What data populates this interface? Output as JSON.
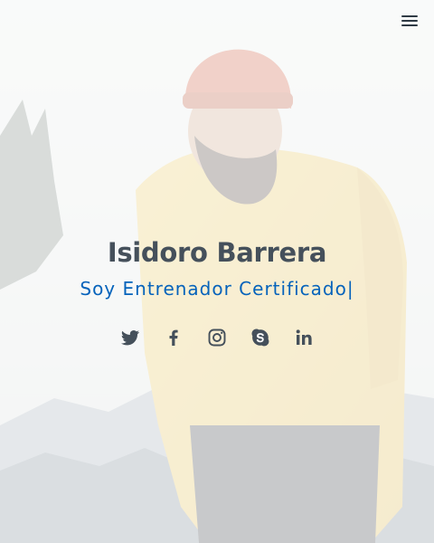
{
  "hero": {
    "name": "Isidoro Barrera",
    "subtitle_prefix": "Soy ",
    "subtitle_typed": "Entrenador Certificado",
    "cursor": "|"
  },
  "menu": {
    "icon": "hamburger-menu-icon"
  },
  "social": [
    {
      "icon": "twitter-icon"
    },
    {
      "icon": "facebook-icon"
    },
    {
      "icon": "instagram-icon"
    },
    {
      "icon": "skype-icon"
    },
    {
      "icon": "linkedin-icon"
    }
  ],
  "colors": {
    "accent": "#0563bb",
    "heading": "#45505b",
    "icon": "#45505b"
  }
}
